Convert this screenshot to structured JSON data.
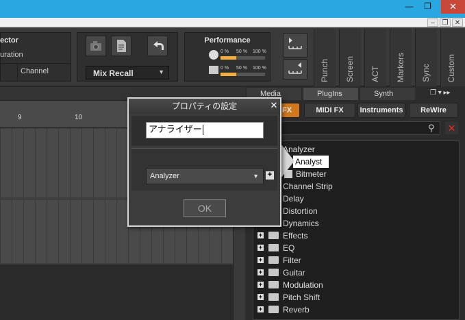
{
  "window": {
    "minimize": "—",
    "maximize": "❐",
    "close": "✕",
    "mdi_minimize": "–",
    "mdi_restore": "❐",
    "mdi_close": "✕"
  },
  "toolbar": {
    "inspector_label": "ector",
    "configuration_label": "uration",
    "channel_label": "Channel",
    "mix_recall_label": "Mix Recall",
    "performance": {
      "title": "Performance",
      "row1": {
        "low": "0 %",
        "mid": "50 %",
        "high": "100 %",
        "level": 0.36
      },
      "row2": {
        "low": "0 %",
        "mid": "50 %",
        "high": "100 %",
        "level": 0.36
      }
    },
    "vtabs": [
      "Punch",
      "Screen",
      "ACT",
      "Markers",
      "Sync",
      "Custom"
    ]
  },
  "ruler": {
    "marks": [
      "9",
      "10"
    ]
  },
  "browser": {
    "tabs": [
      "Media",
      "PlugIns",
      "Synth"
    ],
    "categories": [
      "FX",
      "MIDI FX",
      "Instruments",
      "ReWire"
    ],
    "tree": [
      {
        "label": "Analyzer",
        "type": "folder-open"
      },
      {
        "label": "Analyst",
        "type": "plugin-selected"
      },
      {
        "label": "Bitmeter",
        "type": "plugin"
      },
      {
        "label": "Channel Strip",
        "type": "folder"
      },
      {
        "label": "Delay",
        "type": "folder"
      },
      {
        "label": "Distortion",
        "type": "folder"
      },
      {
        "label": "Dynamics",
        "type": "folder"
      },
      {
        "label": "Effects",
        "type": "folder"
      },
      {
        "label": "EQ",
        "type": "folder"
      },
      {
        "label": "Filter",
        "type": "folder"
      },
      {
        "label": "Guitar",
        "type": "folder"
      },
      {
        "label": "Modulation",
        "type": "folder"
      },
      {
        "label": "Pitch Shift",
        "type": "folder"
      },
      {
        "label": "Reverb",
        "type": "folder"
      }
    ]
  },
  "dialog": {
    "title": "プロパティの設定",
    "name_value": "アナライザー",
    "category_selected": "Analyzer",
    "add_label": "+",
    "ok_label": "OK"
  }
}
